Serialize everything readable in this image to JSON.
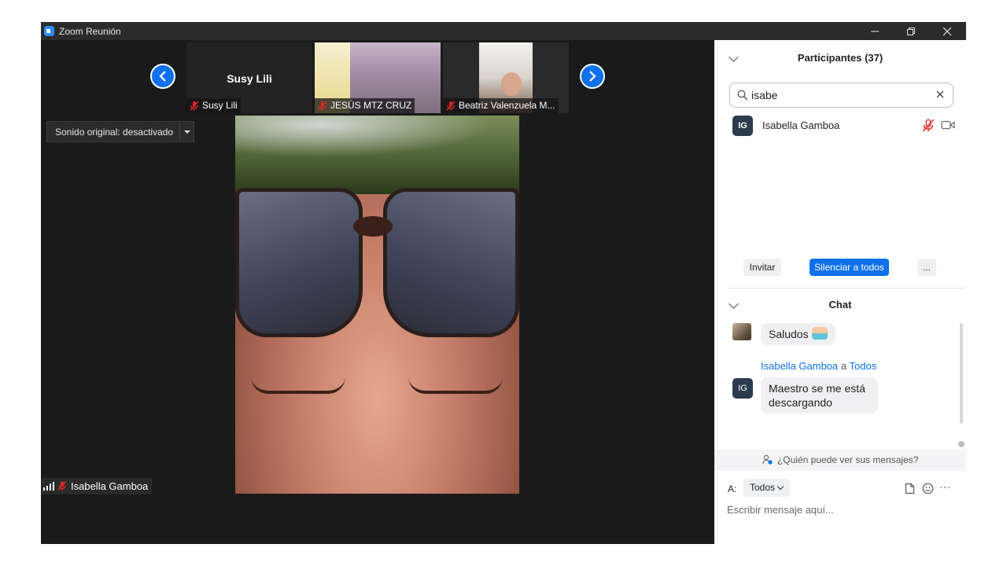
{
  "window": {
    "title": "Zoom Reunión"
  },
  "colors": {
    "accent": "#0e71eb",
    "mute_red": "#e02828",
    "panel_bg": "#ffffff",
    "stage_bg": "#1a1a1a"
  },
  "icons": {
    "app": "zoom-icon",
    "minimize": "minimize-icon",
    "restore": "restore-icon",
    "close": "close-icon"
  },
  "gallery": {
    "thumbnails": [
      {
        "display_name": "Susy Lili",
        "name_tag": "Susy Lili",
        "muted": true,
        "video": false
      },
      {
        "display_name": "",
        "name_tag": "JESÚS MTZ CRUZ",
        "muted": true,
        "video": true
      },
      {
        "display_name": "",
        "name_tag": "Beatriz Valenzuela M...",
        "muted": true,
        "video": true
      }
    ]
  },
  "stage": {
    "original_sound_label": "Sonido original: desactivado",
    "active_speaker": "Isabella Gamboa"
  },
  "participants": {
    "title": "Participantes (37)",
    "search_value": "isabe",
    "list": [
      {
        "initials": "IG",
        "name": "Isabella Gamboa",
        "muted": true,
        "video_on": false
      }
    ],
    "invite_label": "Invitar",
    "mute_all_label": "Silenciar a todos",
    "more_label": "..."
  },
  "chat": {
    "title": "Chat",
    "messages": [
      {
        "text": "Saludos",
        "has_emoji": true
      },
      {
        "sender": "Isabella Gamboa",
        "connector": "a",
        "recipient": "Todos",
        "initials": "IG",
        "text": "Maestro se me está descargando"
      }
    ],
    "who_can_see": "¿Quién puede ver sus mensajes?",
    "to_label": "A:",
    "to_value": "Todos",
    "more_label": "···",
    "input_placeholder": "Escribir mensaje aquí..."
  }
}
